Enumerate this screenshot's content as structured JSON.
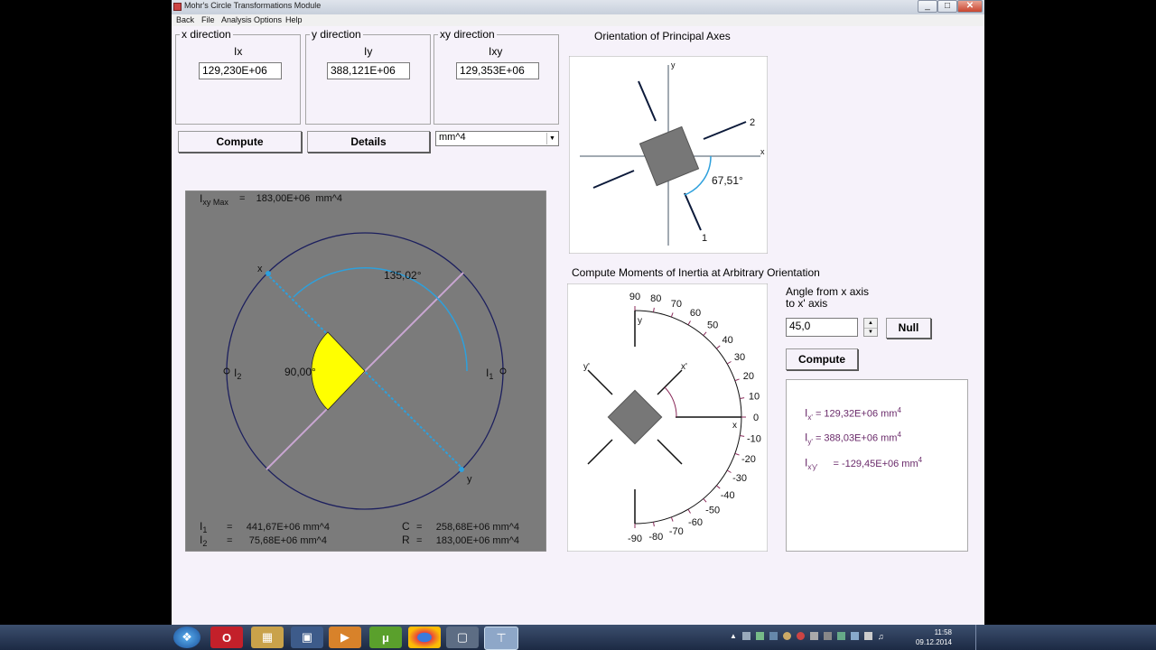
{
  "window": {
    "title": "Mohr's Circle Transformations Module"
  },
  "menu": [
    "Back",
    "File",
    "Analysis Options",
    "Help"
  ],
  "inputs": {
    "x": {
      "group": "x direction",
      "label": "Ix",
      "value": "129,230E+06"
    },
    "y": {
      "group": "y direction",
      "label": "Iy",
      "value": "388,121E+06"
    },
    "xy": {
      "group": "xy direction",
      "label": "Ixy",
      "value": "129,353E+06"
    }
  },
  "buttons": {
    "compute": "Compute",
    "details": "Details",
    "null": "Null",
    "compute2": "Compute"
  },
  "unit_select": "mm^4",
  "mohr": {
    "ixy_max_prefix": "I",
    "ixy_max_sub": "xy Max",
    "ixy_max_value": "=    183,00E+06  mm^4",
    "angle_big": "135,02°",
    "angle_small": "90,00°",
    "lbl_x": "x",
    "lbl_y": "y",
    "lbl_i1": "I",
    "lbl_i1_sub": "1",
    "lbl_i2": "I",
    "lbl_i2_sub": "2",
    "i1_label": "I",
    "i1_sub": "1",
    "i1_value": "=     441,67E+06 mm^4",
    "i2_label": "I",
    "i2_sub": "2",
    "i2_value": "=      75,68E+06 mm^4",
    "c_label": "C",
    "c_value": "=     258,68E+06 mm^4",
    "r_label": "R",
    "r_value": "=     183,00E+06 mm^4"
  },
  "principal": {
    "title": "Orientation of Principal Axes",
    "angle": "67,51°",
    "axis_x": "x",
    "axis_y": "y",
    "axis_1": "1",
    "axis_2": "2"
  },
  "arbitrary": {
    "title": "Compute Moments of Inertia at Arbitrary Orientation",
    "angle_label_1": "Angle from x axis",
    "angle_label_2": "to x' axis",
    "angle_value": "45,0",
    "scale_labels": [
      "90",
      "80",
      "70",
      "60",
      "50",
      "40",
      "30",
      "20",
      "10",
      "0",
      "-10",
      "-20",
      "-30",
      "-40",
      "-50",
      "-60",
      "-70",
      "-80",
      "-90"
    ],
    "axis_x": "x",
    "axis_y": "y",
    "axis_xp": "x'",
    "axis_yp": "y'"
  },
  "results": {
    "ix_label": "I",
    "ix_sub": "x'",
    "ix_value": "= 129,32E+06 mm",
    "iy_label": "I",
    "iy_sub": "y'",
    "iy_value": "= 388,03E+06 mm",
    "ixy_label": "I",
    "ixy_sub": "x'y'",
    "ixy_value": "= -129,45E+06 mm",
    "exp": "4"
  },
  "colors": {
    "mohr_bg": "#7b7b7b",
    "sector": "#ffff00",
    "circle": "#1c1f5e",
    "diameter": "#2ea0dc",
    "principal_line": "#c9a6d2",
    "result_text": "#6a2a6a",
    "scale_tick": "#8a2a5a"
  },
  "taskbar": {
    "icons": [
      "windows-start-icon",
      "opera-icon",
      "explorer-icon",
      "save-icon",
      "media-player-icon",
      "utorrent-icon",
      "chrome-icon",
      "window-icon",
      "app-icon"
    ],
    "time": "11:58",
    "date": "09.12.2014"
  }
}
